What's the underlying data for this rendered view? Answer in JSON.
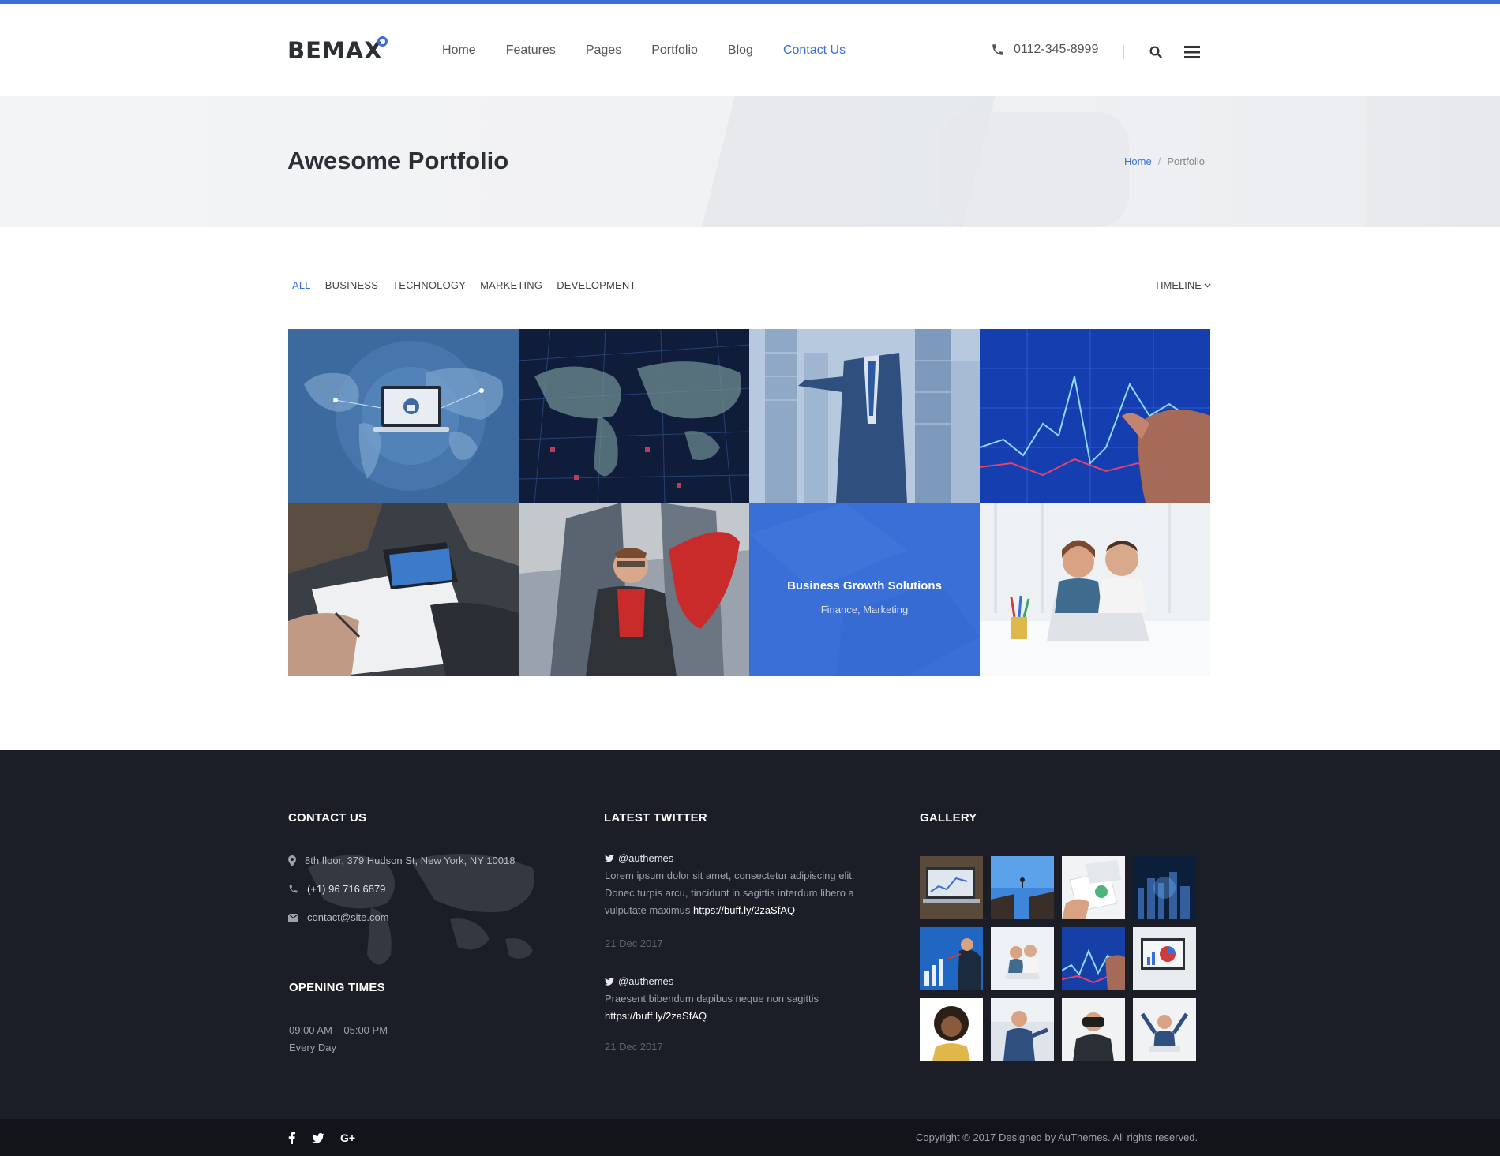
{
  "colors": {
    "accent": "#3a6fd8",
    "footer_bg": "#1b1e26",
    "bottom_bar_bg": "#121419"
  },
  "header": {
    "logo": "BEMAX",
    "nav": [
      {
        "label": "Home",
        "active": false
      },
      {
        "label": "Features",
        "active": false
      },
      {
        "label": "Pages",
        "active": false
      },
      {
        "label": "Portfolio",
        "active": false
      },
      {
        "label": "Blog",
        "active": false
      },
      {
        "label": "Contact Us",
        "active": true
      }
    ],
    "phone": "0112-345-8999",
    "icons": [
      "phone-icon",
      "search-icon",
      "menu-icon"
    ]
  },
  "title_band": {
    "title": "Awesome Portfolio",
    "breadcrumb": {
      "home": "Home",
      "separator": "/",
      "current": "Portfolio"
    }
  },
  "filters": {
    "items": [
      "ALL",
      "BUSINESS",
      "TECHNOLOGY",
      "MARKETING",
      "DEVELOPMENT"
    ],
    "active": "ALL",
    "sort": "TIMELINE"
  },
  "portfolio": {
    "items": [
      {
        "image": "world map with laptop and padlock"
      },
      {
        "image": "digital world map on dark grid"
      },
      {
        "image": "businessman in city skyscrapers"
      },
      {
        "image": "hand touching financial chart screen"
      },
      {
        "image": "team meeting with tablet and papers"
      },
      {
        "image": "businessman superhero with red cape"
      },
      {
        "image": "business growth overlay",
        "title": "Business Growth Solutions",
        "categories": "Finance, Marketing"
      },
      {
        "image": "happy couple at laptop"
      }
    ]
  },
  "footer": {
    "contact": {
      "heading": "CONTACT US",
      "address": "8th floor, 379 Hudson St, New York, NY 10018",
      "phone": "(+1) 96 716 6879",
      "email": "contact@site.com"
    },
    "opening": {
      "heading": "OPENING TIMES",
      "hours": "09:00 AM – 05:00 PM",
      "days": "Every Day"
    },
    "twitter": {
      "heading": "LATEST TWITTER",
      "tweets": [
        {
          "handle": "@authemes",
          "text": "Lorem ipsum dolor sit amet, consectetur adipiscing elit. Donec turpis arcu, tincidunt in sagittis interdum libero a vulputate maximus",
          "link": "https://buff.ly/2zaSfAQ",
          "date": "21 Dec 2017"
        },
        {
          "handle": "@authemes",
          "text": "Praesent bibendum dapibus neque non sagittis",
          "link": "https://buff.ly/2zaSfAQ",
          "date": "21 Dec 2017"
        }
      ]
    },
    "gallery": {
      "heading": "GALLERY",
      "images": [
        "analytics laptop",
        "cliff jump",
        "documents desk",
        "city night",
        "chart businesswoman",
        "happy couple",
        "finance screen",
        "pie chart monitor",
        "smiling woman",
        "businessman pointing",
        "binoculars man",
        "celebrating man"
      ]
    }
  },
  "bottom_bar": {
    "social": [
      "facebook-icon",
      "twitter-icon",
      "google-plus-icon"
    ],
    "copyright": "Copyright © 2017 Designed by AuThemes. All rights reserved."
  }
}
